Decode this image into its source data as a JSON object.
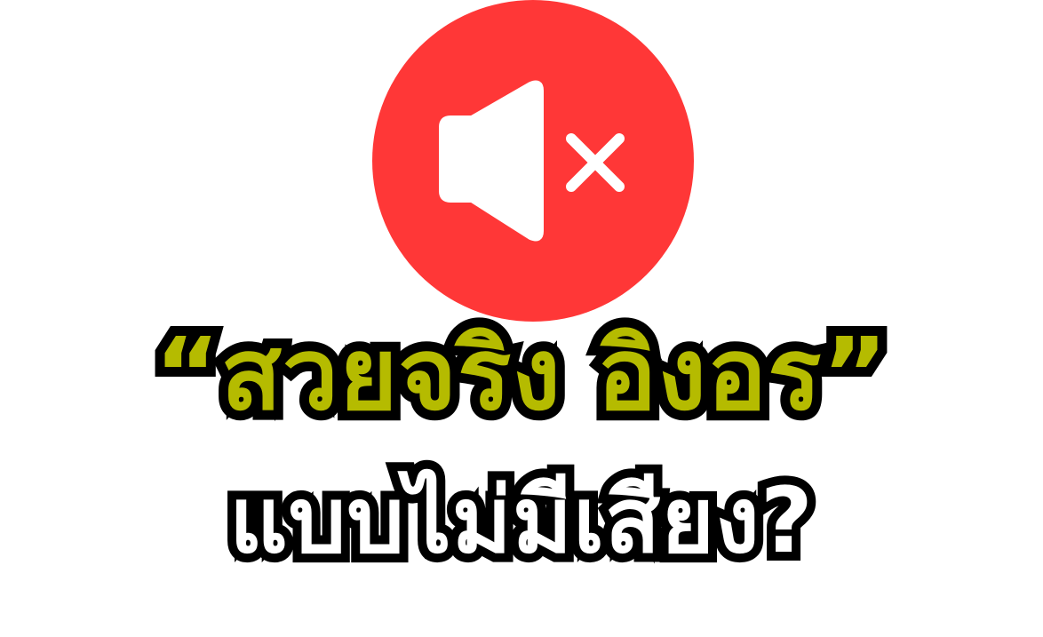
{
  "icon": {
    "name": "speaker-muted-icon",
    "background_color": "#ff3737",
    "glyph_color": "#ffffff"
  },
  "headline": {
    "line1": "“สวยจริง อิงอร”",
    "line1_color": "#b5bb00",
    "line2": "แบบไม่มีเสียง?",
    "line2_color": "#ffffff",
    "outline_color": "#000000"
  }
}
